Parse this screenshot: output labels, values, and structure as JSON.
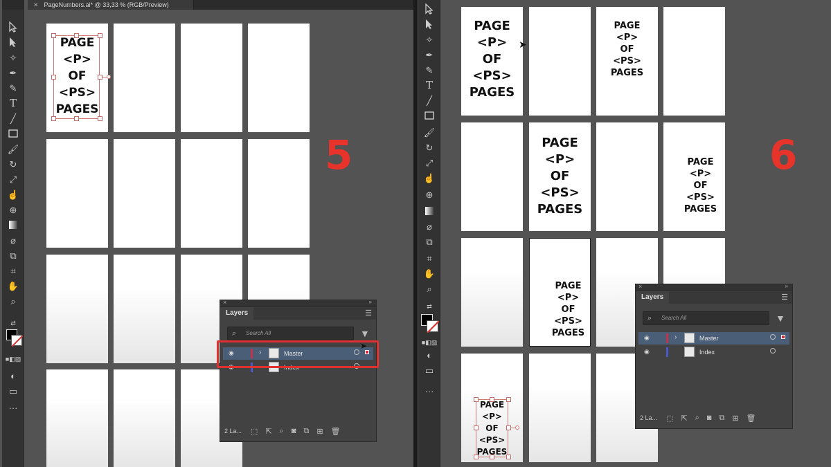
{
  "left": {
    "tab_close": "✕",
    "tab_title": "PageNumbers.ai* @ 33,33 % (RGB/Preview)",
    "step_number": "5",
    "artboard_lines": [
      "PAGE",
      "<P>",
      "OF",
      "<PS>",
      "PAGES"
    ],
    "layers_panel": {
      "title": "Layers",
      "search_placeholder": "Search All",
      "layers": [
        {
          "name": "Master",
          "color": "#c0354a"
        },
        {
          "name": "Index",
          "color": "#4a5ac8"
        }
      ],
      "count_label": "2 La..."
    }
  },
  "right": {
    "step_number": "6",
    "artboard_lines": [
      "PAGE",
      "<P>",
      "OF",
      "<PS>",
      "PAGES"
    ],
    "layers_panel": {
      "title": "Layers",
      "search_placeholder": "Search All",
      "layers": [
        {
          "name": "Master",
          "color": "#c0354a"
        },
        {
          "name": "Index",
          "color": "#4a5ac8"
        }
      ],
      "count_label": "2 La..."
    }
  },
  "colors": {
    "highlight": "#e03131",
    "step_number": "#e8332b",
    "selection": "#d07878"
  },
  "icons": [
    "selection-icon",
    "direct-selection-icon",
    "magic-wand-icon",
    "pen-icon",
    "curvature-icon",
    "type-icon",
    "line-icon",
    "rectangle-icon",
    "paintbrush-icon",
    "rotate-icon",
    "scale-icon",
    "puppet-warp-icon",
    "shape-builder-icon",
    "gradient-icon",
    "eyedropper-icon",
    "blend-icon",
    "artboard-icon",
    "hand-icon",
    "zoom-icon",
    "eye-icon",
    "search-icon",
    "filter-icon",
    "panel-menu-icon",
    "chevron-right-icon",
    "target-icon",
    "trash-icon"
  ]
}
